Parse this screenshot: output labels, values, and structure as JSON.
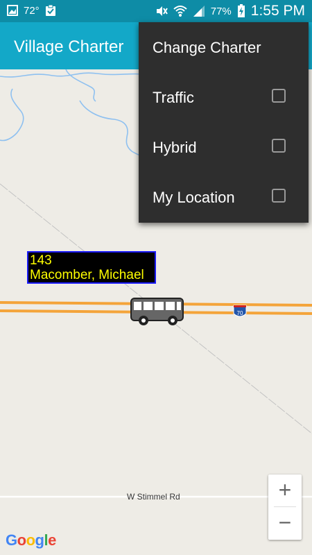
{
  "status_bar": {
    "temperature": "72°",
    "battery": "77%",
    "time": "1:55 PM"
  },
  "app_bar": {
    "title": "Village Charter"
  },
  "menu": {
    "items": [
      {
        "label": "Change Charter",
        "has_checkbox": false
      },
      {
        "label": "Traffic",
        "has_checkbox": true,
        "checked": false
      },
      {
        "label": "Hybrid",
        "has_checkbox": true,
        "checked": false
      },
      {
        "label": "My Location",
        "has_checkbox": true,
        "checked": false
      }
    ]
  },
  "map": {
    "vehicle": {
      "number": "143",
      "driver": "Macomber, Michael",
      "icon": "bus-icon"
    },
    "highway_shield": "70",
    "road_label": "W Stimmel Rd",
    "attribution": "Google",
    "zoom_in": "+",
    "zoom_out": "−"
  },
  "colors": {
    "status_bar": "#0e8ca6",
    "app_bar": "#13a8c8",
    "menu_bg": "#2e2e2e",
    "map_bg": "#eeece6",
    "highway": "#f4a43a",
    "water": "#8ec0f0",
    "vehicle_label_bg": "#000000",
    "vehicle_label_text": "#ffff00",
    "vehicle_label_border": "#1a1aff"
  }
}
